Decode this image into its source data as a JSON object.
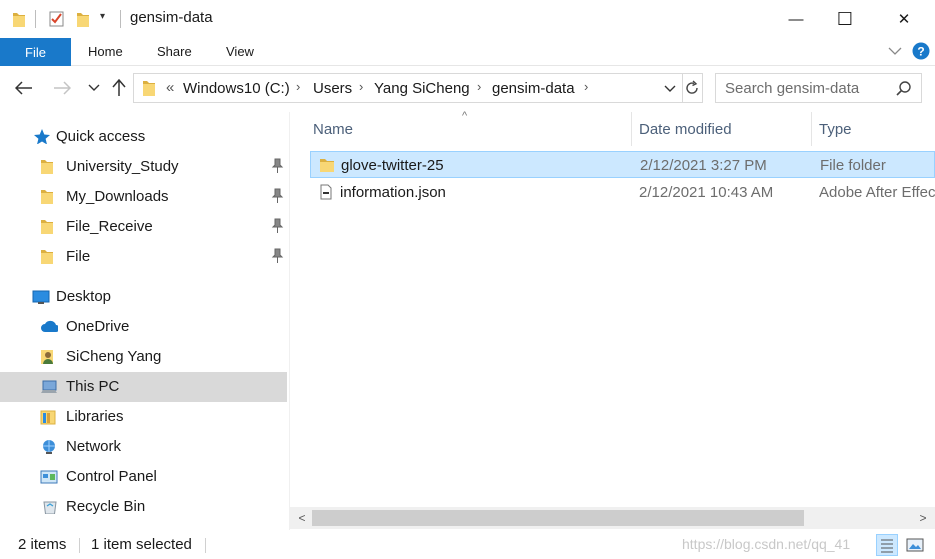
{
  "window": {
    "title": "gensim-data",
    "minimize": "—",
    "maximize": "☐",
    "close": "✕"
  },
  "ribbon": {
    "file": "File",
    "home": "Home",
    "share": "Share",
    "view": "View"
  },
  "address": {
    "overflow": "«",
    "crumbs": [
      "Windows10 (C:)",
      "Users",
      "Yang SiCheng",
      "gensim-data"
    ]
  },
  "search": {
    "placeholder": "Search gensim-data"
  },
  "nav": {
    "quick_access": "Quick access",
    "pinned": [
      "University_Study",
      "My_Downloads",
      "File_Receive",
      "File"
    ],
    "desktop": "Desktop",
    "onedrive": "OneDrive",
    "user": "SiCheng Yang",
    "this_pc": "This PC",
    "libraries": "Libraries",
    "network": "Network",
    "control_panel": "Control Panel",
    "recycle_bin": "Recycle Bin"
  },
  "columns": {
    "name": "Name",
    "date": "Date modified",
    "type": "Type"
  },
  "files": [
    {
      "name": "glove-twitter-25",
      "date": "2/12/2021 3:27 PM",
      "type": "File folder",
      "icon": "folder-icon",
      "selected": true
    },
    {
      "name": "information.json",
      "date": "2/12/2021 10:43 AM",
      "type": "Adobe After Effec",
      "icon": "json-file-icon",
      "selected": false
    }
  ],
  "status": {
    "items": "2 items",
    "selected": "1 item selected"
  },
  "watermark": "https://blog.csdn.net/qq_41",
  "colors": {
    "accent": "#1979ca",
    "selection": "#cce8ff",
    "folder": "#f8d775"
  }
}
